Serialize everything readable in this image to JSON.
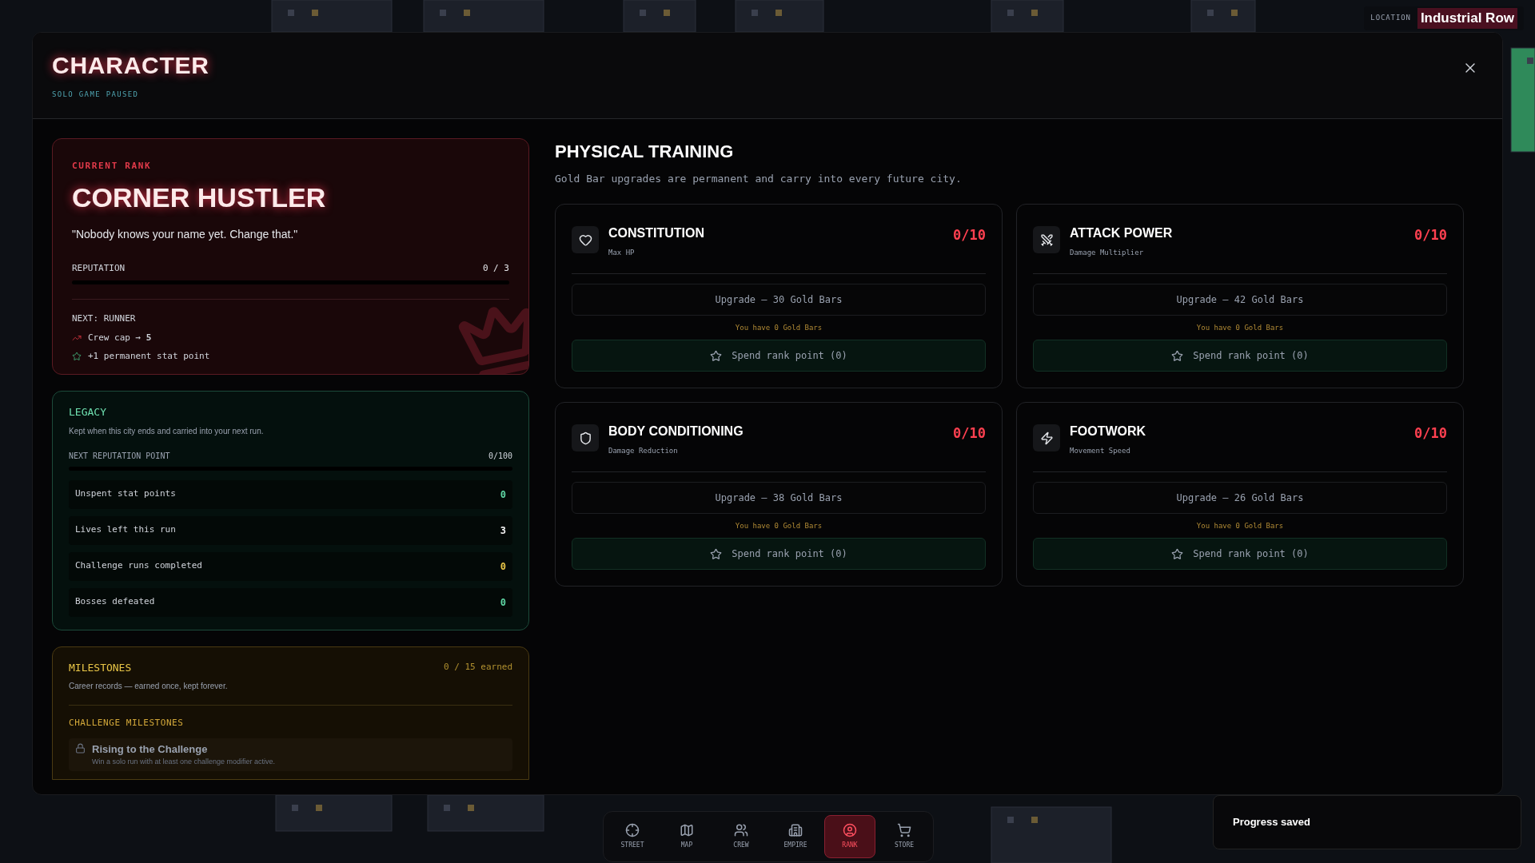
{
  "location": {
    "label": "LOCATION",
    "value": "Industrial Row"
  },
  "header": {
    "title": "CHARACTER",
    "subtitle": "SOLO GAME PAUSED"
  },
  "rank": {
    "eyebrow": "CURRENT RANK",
    "title": "CORNER HUSTLER",
    "quote": "\"Nobody knows your name yet. Change that.\"",
    "progress_label": "REPUTATION",
    "progress_value": "0 / 3",
    "level": 0,
    "next": "NEXT: RUNNER",
    "perks": [
      {
        "kind": "trend",
        "text": "Crew cap → **5**"
      },
      {
        "kind": "star",
        "text": "+1 permanent stat point"
      }
    ]
  },
  "legacy": {
    "title": "LEGACY",
    "description": "Kept when this city ends and carried into your next run.",
    "progress_label": "NEXT REPUTATION POINT",
    "progress_value": "0/100",
    "level": 0,
    "stats": [
      {
        "label": "Unspent stat points",
        "value": "0",
        "color": "#5fd6a4"
      },
      {
        "label": "Lives left this run",
        "value": "3",
        "color": "#f2f2f2"
      },
      {
        "label": "Challenge runs completed",
        "value": "0",
        "color": "#e8c547"
      },
      {
        "label": "Bosses defeated",
        "value": "0",
        "color": "#5fd6a4"
      }
    ]
  },
  "milestones": {
    "title": "MILESTONES",
    "count": "0 / 15 earned",
    "description": "Career records — earned once, kept forever.",
    "section": "CHALLENGE MILESTONES",
    "items": [
      {
        "title": "Rising to the Challenge",
        "description": "Win a solo run with at least one challenge modifier active.",
        "locked": true
      }
    ]
  },
  "training": {
    "title": "PHYSICAL TRAINING",
    "subtitle": "Gold Bar upgrades are permanent and carry into every future city.",
    "cards": [
      {
        "kind": "heart",
        "name": "CONSTITUTION",
        "stat": "Max HP",
        "progress": "0/10",
        "maxed": false,
        "upgrade": "Upgrade — 30 Gold Bars",
        "balance": "You have 0 Gold Bars",
        "spend": "Spend rank point (0)"
      },
      {
        "kind": "swords",
        "name": "ATTACK POWER",
        "stat": "Damage Multiplier",
        "progress": "0/10",
        "maxed": false,
        "upgrade": "Upgrade — 42 Gold Bars",
        "balance": "You have 0 Gold Bars",
        "spend": "Spend rank point (0)"
      },
      {
        "kind": "shield",
        "name": "BODY CONDITIONING",
        "stat": "Damage Reduction",
        "progress": "0/10",
        "maxed": false,
        "upgrade": "Upgrade — 38 Gold Bars",
        "balance": "You have 0 Gold Bars",
        "spend": "Spend rank point (0)"
      },
      {
        "kind": "bolt",
        "name": "FOOTWORK",
        "stat": "Movement Speed",
        "progress": "0/10",
        "maxed": false,
        "upgrade": "Upgrade — 26 Gold Bars",
        "balance": "You have 0 Gold Bars",
        "spend": "Spend rank point (0)"
      }
    ]
  },
  "nav": [
    {
      "kind": "crosshair",
      "label": "STREET",
      "selected": false
    },
    {
      "kind": "map",
      "label": "MAP",
      "selected": false
    },
    {
      "kind": "crew",
      "label": "CREW",
      "selected": false
    },
    {
      "kind": "building",
      "label": "EMPIRE",
      "selected": false
    },
    {
      "kind": "user",
      "label": "RANK",
      "selected": true
    },
    {
      "kind": "cart",
      "label": "STORE",
      "selected": false
    }
  ],
  "toast": {
    "text": "Progress saved"
  }
}
